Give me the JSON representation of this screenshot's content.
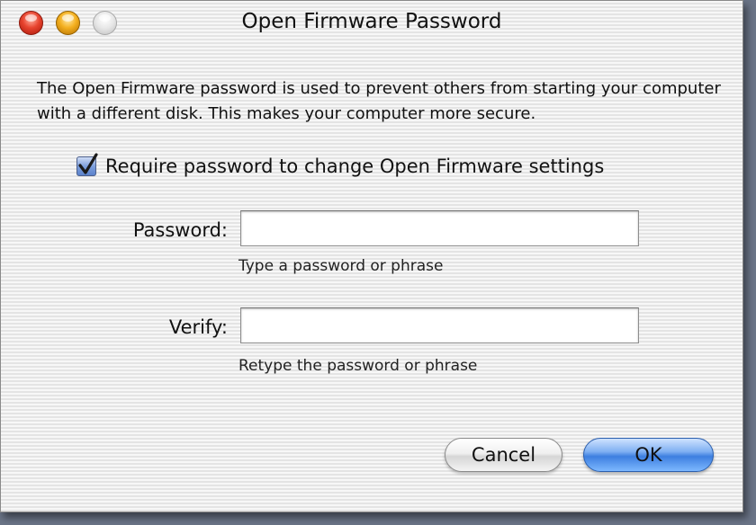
{
  "window": {
    "title": "Open Firmware Password"
  },
  "description": "The Open Firmware password is used to prevent others from starting your computer with a different disk. This makes your computer more secure.",
  "require_password": {
    "checked": true,
    "label": "Require password to change Open Firmware settings"
  },
  "password_field": {
    "label": "Password:",
    "value": "",
    "hint": "Type a password or phrase"
  },
  "verify_field": {
    "label": "Verify:",
    "value": "",
    "hint": "Retype the password or phrase"
  },
  "buttons": {
    "cancel_label": "Cancel",
    "ok_label": "OK"
  },
  "colors": {
    "close": "#e8442f",
    "minimize": "#f4b020",
    "zoom": "#e6e6e6",
    "default_button": "#3d7fe0"
  }
}
